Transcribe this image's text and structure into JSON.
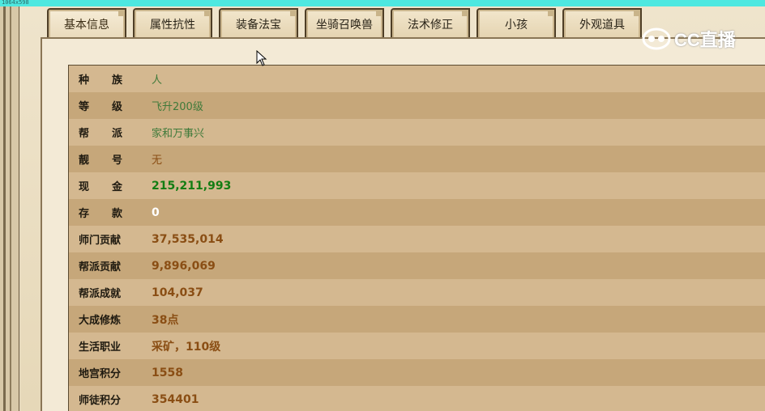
{
  "overlay": {
    "tiny_label": "1064x598"
  },
  "tabs": [
    {
      "label": "基本信息",
      "active": true
    },
    {
      "label": "属性抗性"
    },
    {
      "label": "装备法宝"
    },
    {
      "label": "坐骑召唤兽"
    },
    {
      "label": "法术修正"
    },
    {
      "label": "小孩"
    },
    {
      "label": "外观道具"
    }
  ],
  "watermark": {
    "text": "CC直播"
  },
  "rows": [
    {
      "label": "种族",
      "value": "人"
    },
    {
      "label": "等级",
      "value": "飞升200级"
    },
    {
      "label": "帮派",
      "value": "家和万事兴"
    },
    {
      "label": "靓号",
      "value": "无"
    },
    {
      "label": "现金",
      "value": "215,211,993"
    },
    {
      "label": "存款",
      "value": "0"
    },
    {
      "label": "师门贡献",
      "value": "37,535,014"
    },
    {
      "label": "帮派贡献",
      "value": "9,896,069"
    },
    {
      "label": "帮派成就",
      "value": "104,037"
    },
    {
      "label": "大成修炼",
      "value": "38点"
    },
    {
      "label": "生活职业",
      "value": "采矿，110级"
    },
    {
      "label": "地宫积分",
      "value": "1558"
    },
    {
      "label": "师徒积分",
      "value": "354401"
    }
  ],
  "colors": {
    "top_strip": "#4ee8e0",
    "row_light": "#d4b890",
    "row_dark": "#c6a77a",
    "value_green": "#3f7a3a",
    "value_brown": "#8a4e14",
    "value_cash": "#137d13",
    "value_white": "#ffffff"
  }
}
